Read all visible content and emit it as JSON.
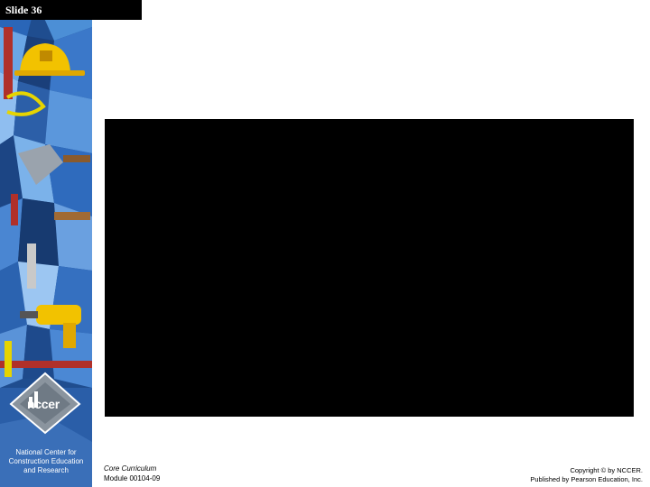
{
  "slide": {
    "label": "Slide 36"
  },
  "sidebar": {
    "logo_text": "nccer",
    "org_name": "National Center for Construction Education and Research"
  },
  "footer": {
    "course_name": "Core Curriculum",
    "module": "Module 00104-09",
    "copyright_line1": "Copyright © by NCCER.",
    "copyright_line2": "Published by Pearson Education, Inc."
  },
  "colors": {
    "sidebar_blue": "#1f4d8f",
    "media_background": "#000000",
    "label_background": "#000000"
  }
}
